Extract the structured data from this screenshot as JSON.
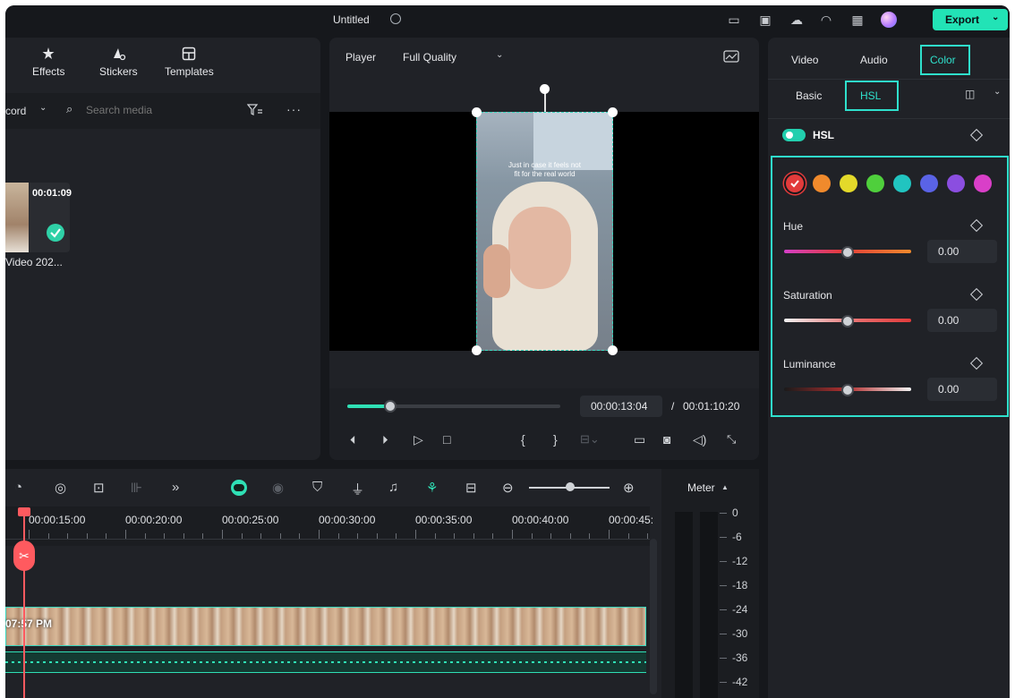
{
  "window": {
    "title": "Untitled"
  },
  "topbar": {
    "export_label": "Export"
  },
  "media_panel": {
    "tabs": [
      {
        "label": "Effects",
        "icon": "effects-icon"
      },
      {
        "label": "Stickers",
        "icon": "stickers-icon"
      },
      {
        "label": "Templates",
        "icon": "templates-icon"
      }
    ],
    "record_label": "cord",
    "search_placeholder": "Search media",
    "clip": {
      "duration": "00:01:09",
      "name": "Video 202..."
    }
  },
  "player": {
    "label": "Player",
    "quality": "Full Quality",
    "current_time": "00:00:13:04",
    "separator": "/",
    "total_time": "00:01:10:20",
    "caption_line1": "Just in case it feels not",
    "caption_line2": "fit for the real world",
    "progress": 0.2
  },
  "right_panel": {
    "tabs": [
      "Video",
      "Audio",
      "Color"
    ],
    "active_tab": "Color",
    "subtabs": [
      "Basic",
      "HSL"
    ],
    "active_subtab": "HSL",
    "hsl_toggle_label": "HSL",
    "swatches": [
      "#e23b3b",
      "#f08a2c",
      "#e3d92a",
      "#4fcf3c",
      "#21c4c0",
      "#5a63e6",
      "#8b4ee0",
      "#d93fc8"
    ],
    "controls": [
      {
        "label": "Hue",
        "value": "0.00",
        "level": 0.5
      },
      {
        "label": "Saturation",
        "value": "0.00",
        "level": 0.5
      },
      {
        "label": "Luminance",
        "value": "0.00",
        "level": 0.5
      }
    ]
  },
  "timeline": {
    "ruler": [
      "00:00:15:00",
      "00:00:20:00",
      "00:00:25:00",
      "00:00:30:00",
      "00:00:35:00",
      "00:00:40:00",
      "00:00:45:"
    ],
    "clip_time_label": "07:57 PM",
    "meter_title": "Meter",
    "meter_scale": [
      "0",
      "-6",
      "-12",
      "-18",
      "-24",
      "-30",
      "-36",
      "-42"
    ]
  }
}
